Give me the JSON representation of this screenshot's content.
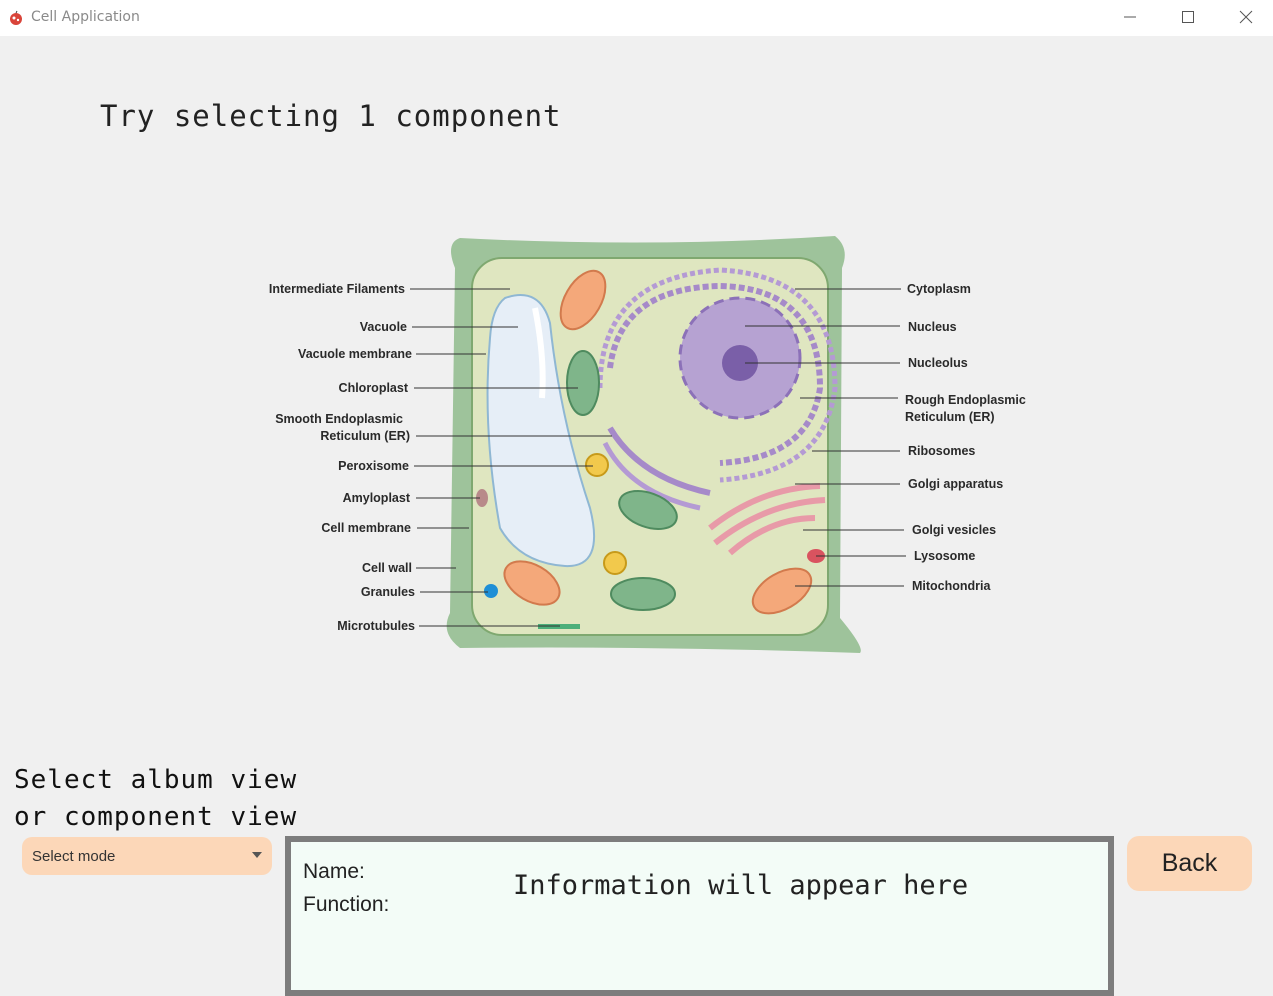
{
  "window": {
    "title": "Cell Application",
    "app_icon": "cell-app-icon",
    "controls": [
      "minimize-icon",
      "maximize-icon",
      "close-icon"
    ]
  },
  "prompt": "Try selecting 1 component",
  "diagram": {
    "labels_left": [
      "Intermediate Filaments",
      "Vacuole",
      "Vacuole membrane",
      "Chloroplast",
      "Smooth Endoplasmic",
      "Reticulum (ER)",
      "Peroxisome",
      "Amyloplast",
      "Cell membrane",
      "Cell wall",
      "Granules",
      "Microtubules"
    ],
    "labels_right": [
      "Cytoplasm",
      "Nucleus",
      "Nucleolus",
      "Rough Endoplasmic",
      "Reticulum (ER)",
      "Ribosomes",
      "Golgi apparatus",
      "Golgi vesicles",
      "Lysosome",
      "Mitochondria"
    ]
  },
  "mode": {
    "label_line1": "Select album view",
    "label_line2": "or component view",
    "select_value": "Select mode"
  },
  "info": {
    "name_label": "Name:",
    "function_label": "Function:",
    "placeholder": "Information will appear here"
  },
  "back_label": "Back",
  "colors": {
    "button_bg": "#fcd7b8",
    "info_bg": "#f3fcf7",
    "info_border": "#7d7d7d",
    "cell_wall": "#9ec39b",
    "cytoplasm": "#dfe6c0"
  }
}
